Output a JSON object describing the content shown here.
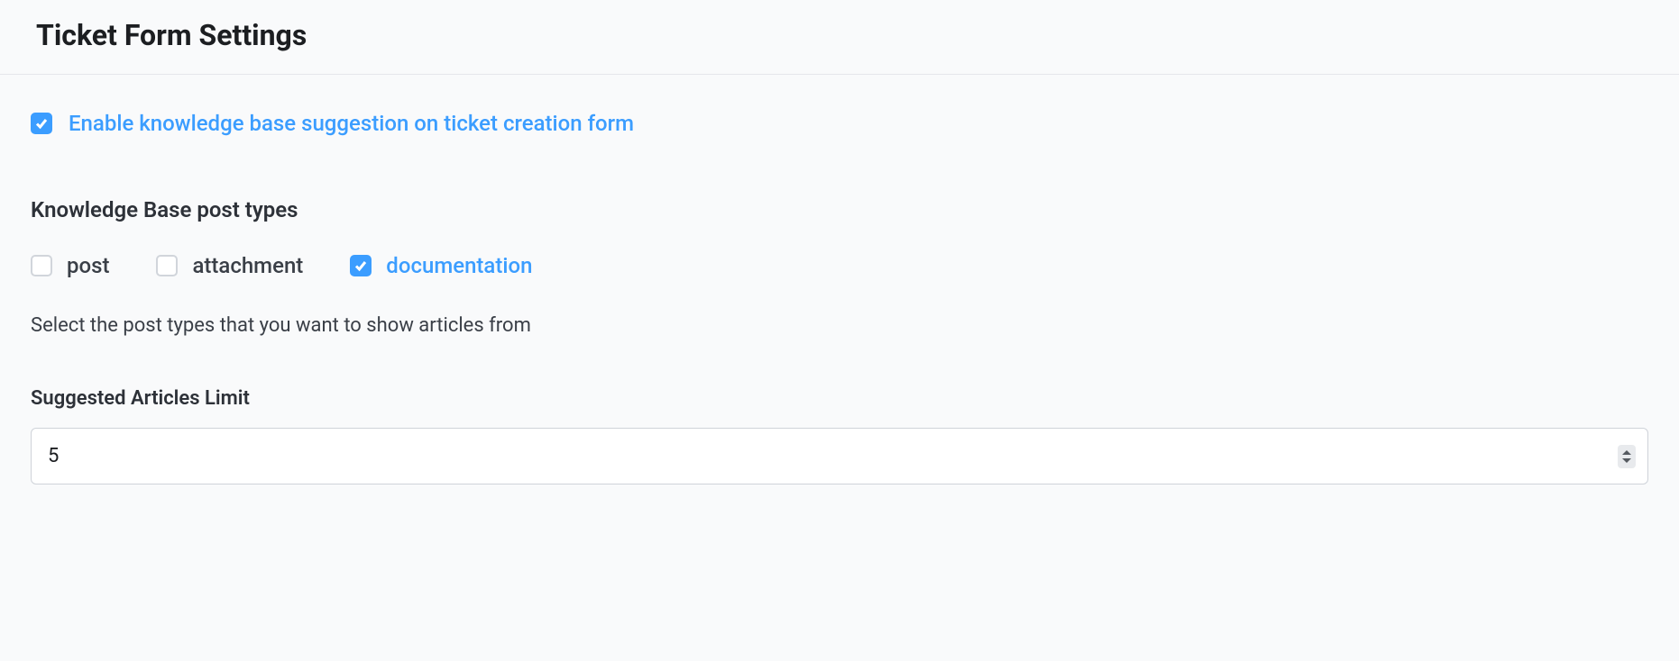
{
  "header": {
    "title": "Ticket Form Settings"
  },
  "enable_kb": {
    "label": "Enable knowledge base suggestion on ticket creation form",
    "checked": true
  },
  "post_types": {
    "heading": "Knowledge Base post types",
    "items": [
      {
        "label": "post",
        "checked": false
      },
      {
        "label": "attachment",
        "checked": false
      },
      {
        "label": "documentation",
        "checked": true
      }
    ],
    "help": "Select the post types that you want to show articles from"
  },
  "suggested_limit": {
    "label": "Suggested Articles Limit",
    "value": "5"
  }
}
